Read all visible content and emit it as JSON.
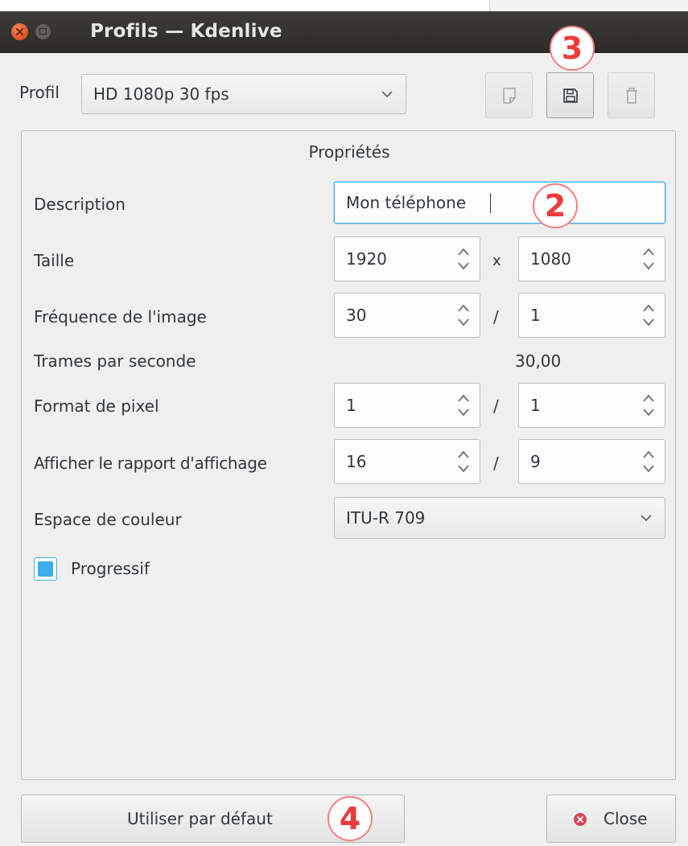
{
  "window": {
    "title": "Profils — Kdenlive"
  },
  "profile": {
    "label": "Profil",
    "selected": "HD 1080p 30 fps",
    "new_icon": "new-document-icon",
    "save_icon": "save-icon",
    "delete_icon": "trash-icon"
  },
  "properties": {
    "group_title": "Propriétés",
    "description": {
      "label": "Description",
      "value": "Mon téléphone"
    },
    "size": {
      "label": "Taille",
      "width": "1920",
      "separator": "x",
      "height": "1080"
    },
    "frame_rate": {
      "label": "Fréquence de l'image",
      "numerator": "30",
      "separator": "/",
      "denominator": "1"
    },
    "fps": {
      "label": "Trames par seconde",
      "value": "30,00"
    },
    "pixel_format": {
      "label": "Format de pixel",
      "numerator": "1",
      "separator": "/",
      "denominator": "1"
    },
    "display_ratio": {
      "label": "Afficher le rapport d'affichage",
      "numerator": "16",
      "separator": "/",
      "denominator": "9"
    },
    "color_space": {
      "label": "Espace de couleur",
      "selected": "ITU-R 709"
    },
    "progressive": {
      "label": "Progressif",
      "checked": true
    }
  },
  "footer": {
    "default_button": "Utiliser par défaut",
    "close_button": "Close"
  },
  "annotations": [
    "2",
    "3",
    "4"
  ],
  "colors": {
    "titlebar": "#2b2a27",
    "accent": "#3daee9",
    "badge": "#ee3b3b",
    "close_icon": "#da4453"
  }
}
